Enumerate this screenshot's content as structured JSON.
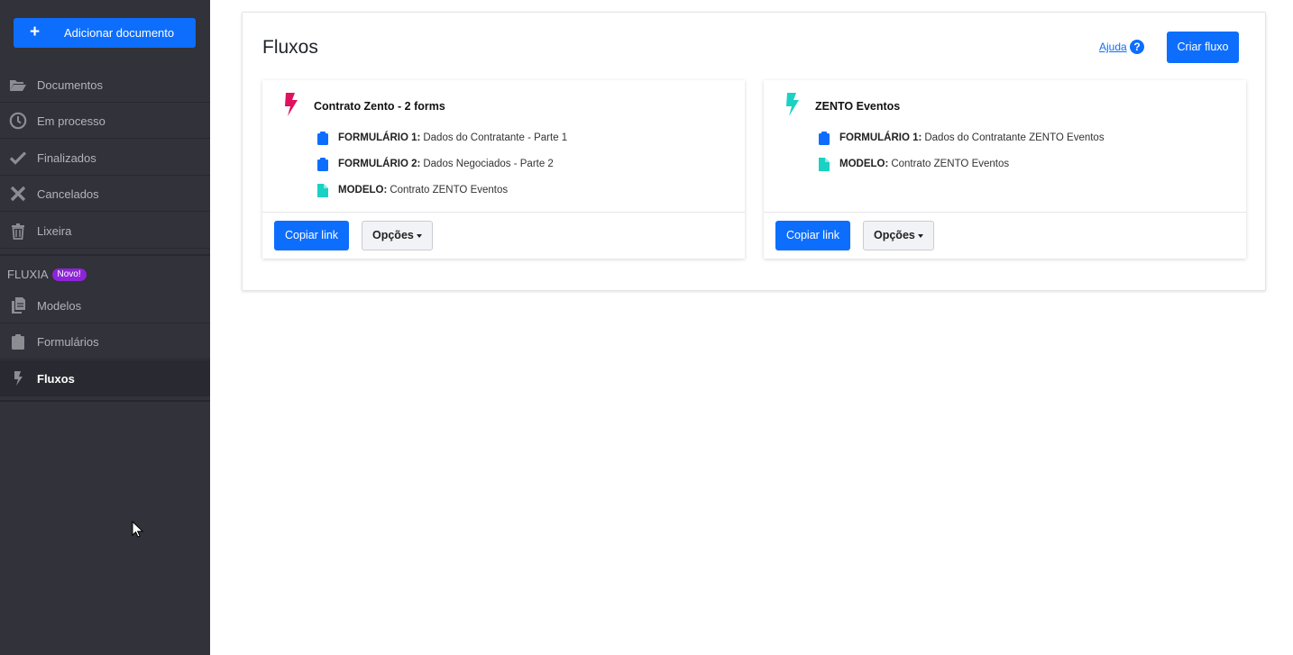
{
  "sidebar": {
    "add_button": {
      "icon": "plus-icon",
      "label": "Adicionar documento"
    },
    "items": [
      {
        "id": "documentos",
        "label": "Documentos",
        "icon": "folder-open-icon"
      },
      {
        "id": "em-processo",
        "label": "Em processo",
        "icon": "clock-icon"
      },
      {
        "id": "finalizados",
        "label": "Finalizados",
        "icon": "check-icon"
      },
      {
        "id": "cancelados",
        "label": "Cancelados",
        "icon": "x-icon"
      },
      {
        "id": "lixeira",
        "label": "Lixeira",
        "icon": "trash-icon"
      }
    ],
    "section": {
      "title": "FLUXIA",
      "badge": "Novo!"
    },
    "section_items": [
      {
        "id": "modelos",
        "label": "Modelos",
        "icon": "copy-icon"
      },
      {
        "id": "formularios",
        "label": "Formulários",
        "icon": "clipboard-icon"
      },
      {
        "id": "fluxos",
        "label": "Fluxos",
        "icon": "bolt-icon",
        "active": true
      }
    ]
  },
  "main": {
    "title": "Fluxos",
    "help_label": "Ajuda",
    "help_icon": "question-circle-icon",
    "create_label": "Criar fluxo",
    "flows": [
      {
        "name": "Contrato Zento - 2 forms",
        "bolt_color": "#e0115f",
        "items": [
          {
            "kind": "FORMULÁRIO 1:",
            "name": "Dados do Contratante - Parte 1",
            "icon": "clipboard-icon",
            "color": "#0d6efd"
          },
          {
            "kind": "FORMULÁRIO 2:",
            "name": "Dados Negociados - Parte 2",
            "icon": "clipboard-icon",
            "color": "#0d6efd"
          },
          {
            "kind": "MODELO:",
            "name": "Contrato ZENTO Eventos",
            "icon": "file-icon",
            "color": "#1bd1c4"
          }
        ],
        "copy_label": "Copiar link",
        "options_label": "Opções"
      },
      {
        "name": "ZENTO Eventos",
        "bolt_color": "#1bd1c4",
        "items": [
          {
            "kind": "FORMULÁRIO 1:",
            "name": "Dados do Contratante ZENTO Eventos",
            "icon": "clipboard-icon",
            "color": "#0d6efd"
          },
          {
            "kind": "MODELO:",
            "name": "Contrato ZENTO Eventos",
            "icon": "file-icon",
            "color": "#1bd1c4"
          }
        ],
        "copy_label": "Copiar link",
        "options_label": "Opções"
      }
    ]
  },
  "colors": {
    "sidebar_bg": "#31323a",
    "primary": "#0d6efd",
    "badge": "#8e24d8"
  }
}
